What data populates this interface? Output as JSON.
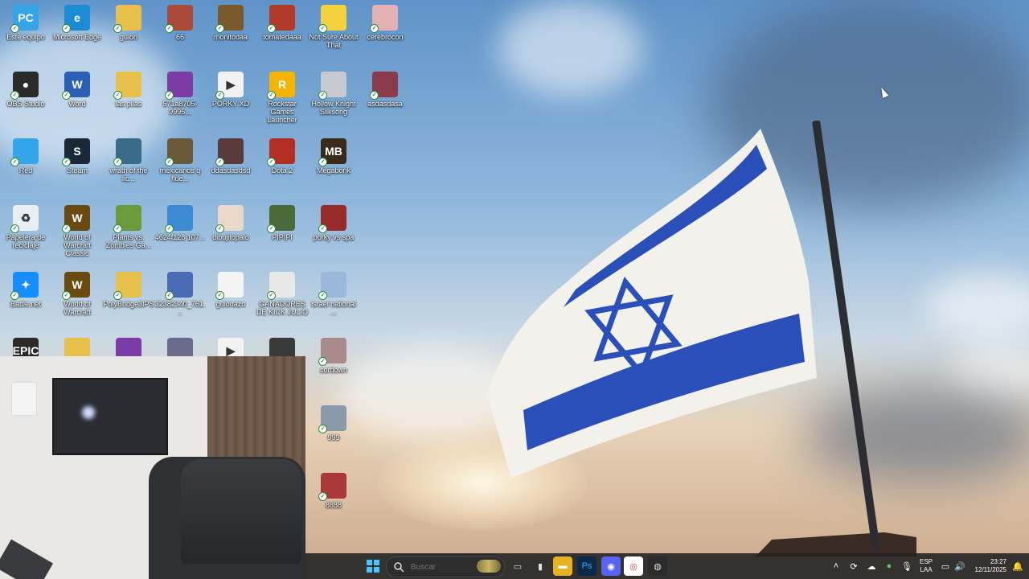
{
  "desktop": {
    "icons": [
      {
        "label": "Este equipo",
        "glyph": "PC",
        "color": "#35a4e8"
      },
      {
        "label": "Microsoft Edge",
        "glyph": "e",
        "color": "#1a8bd4"
      },
      {
        "label": "guion",
        "glyph": "",
        "color": "#e6c04a"
      },
      {
        "label": "66",
        "glyph": "",
        "color": "#a94a3a"
      },
      {
        "label": "monitodaa",
        "glyph": "",
        "color": "#7a5a2a"
      },
      {
        "label": "tomatedaaa",
        "glyph": "",
        "color": "#b23a2a"
      },
      {
        "label": "Not Sure About That",
        "glyph": "",
        "color": "#f3d23b"
      },
      {
        "label": "cerebrocon",
        "glyph": "",
        "color": "#e3b0b4"
      },
      {
        "label": "OBS Studio",
        "glyph": "●",
        "color": "#2b2b2b"
      },
      {
        "label": "Word",
        "glyph": "W",
        "color": "#2b5fb7"
      },
      {
        "label": "las pilas",
        "glyph": "",
        "color": "#e6c04a"
      },
      {
        "label": "571a8705-9995...",
        "glyph": "",
        "color": "#7b3ca8"
      },
      {
        "label": "PORKY XD",
        "glyph": "▶",
        "color": "#f2f2f2"
      },
      {
        "label": "Rockstar Games Launcher",
        "glyph": "R",
        "color": "#f4b400"
      },
      {
        "label": "Hollow Knight Silksong",
        "glyph": "",
        "color": "#c9c9d1"
      },
      {
        "label": "asdasdasa",
        "glyph": "",
        "color": "#8a3a4a"
      },
      {
        "label": "Red",
        "glyph": "",
        "color": "#35a4e8"
      },
      {
        "label": "Steam",
        "glyph": "S",
        "color": "#1b2838"
      },
      {
        "label": "wrath of the lic...",
        "glyph": "",
        "color": "#3a6a8a"
      },
      {
        "label": "mexicanos q flue...",
        "glyph": "",
        "color": "#6a5a3a"
      },
      {
        "label": "ddasdasdsd",
        "glyph": "",
        "color": "#5a3a3a"
      },
      {
        "label": "Dota 2",
        "glyph": "",
        "color": "#b22d22"
      },
      {
        "label": "Megabonk",
        "glyph": "MB",
        "color": "#3a2a1a"
      },
      {
        "label": "Papelera de reciclaje",
        "glyph": "♻",
        "color": "#e8eef4"
      },
      {
        "label": "World of Warcraft Classic",
        "glyph": "W",
        "color": "#6b4a12"
      },
      {
        "label": "Plants vs. Zombies Ga...",
        "glyph": "",
        "color": "#6a9a3a"
      },
      {
        "label": "4624f128 107...",
        "glyph": "",
        "color": "#3a8ad4"
      },
      {
        "label": "dibujitopalo",
        "glyph": "",
        "color": "#e8d8c8"
      },
      {
        "label": "PIPIPI",
        "glyph": "",
        "color": "#4a6a3a"
      },
      {
        "label": "porky vs spa",
        "glyph": "",
        "color": "#9a2a2a"
      },
      {
        "label": "Battle.net",
        "glyph": "✦",
        "color": "#148eff"
      },
      {
        "label": "World of Warcraft",
        "glyph": "W",
        "color": "#6b4a12"
      },
      {
        "label": "PolyBridge3IPS",
        "glyph": "",
        "color": "#e6c04a"
      },
      {
        "label": "32382340_761...",
        "glyph": "",
        "color": "#4a6ab4"
      },
      {
        "label": "guionazo",
        "glyph": "",
        "color": "#f4f4f4"
      },
      {
        "label": "GANADORES DE KICK JULIO",
        "glyph": "",
        "color": "#e8e8e8"
      },
      {
        "label": "israel national ...",
        "glyph": "",
        "color": "#9ab8dc"
      },
      {
        "label": "",
        "glyph": "EPIC",
        "color": "#2a2a2a"
      },
      {
        "label": "",
        "glyph": "",
        "color": "#e6c04a"
      },
      {
        "label": "",
        "glyph": "",
        "color": "#7b3ca8"
      },
      {
        "label": "",
        "glyph": "",
        "color": "#6a6a8a"
      },
      {
        "label": "",
        "glyph": "▶",
        "color": "#f2f2f2"
      },
      {
        "label": "",
        "glyph": "",
        "color": "#3a3a3a"
      },
      {
        "label": "cordown",
        "glyph": "",
        "color": "#aa8a8a"
      },
      {
        "label": "999",
        "glyph": "",
        "color": "#8a9aaa"
      },
      {
        "label": "8888",
        "glyph": "",
        "color": "#aa3a3a"
      }
    ]
  },
  "taskbar": {
    "search_placeholder": "Buscar",
    "apps": [
      {
        "name": "task-view",
        "glyph": "▭"
      },
      {
        "name": "app-generic",
        "glyph": "▮"
      },
      {
        "name": "file-explorer",
        "glyph": "▬"
      },
      {
        "name": "photoshop",
        "glyph": "Ps"
      },
      {
        "name": "discord",
        "glyph": "◉"
      },
      {
        "name": "chrome",
        "glyph": "◎"
      },
      {
        "name": "obs",
        "glyph": "◍"
      }
    ],
    "language_line1": "ESP",
    "language_line2": "LAA",
    "time": "23:27",
    "date": "12/11/2025"
  }
}
